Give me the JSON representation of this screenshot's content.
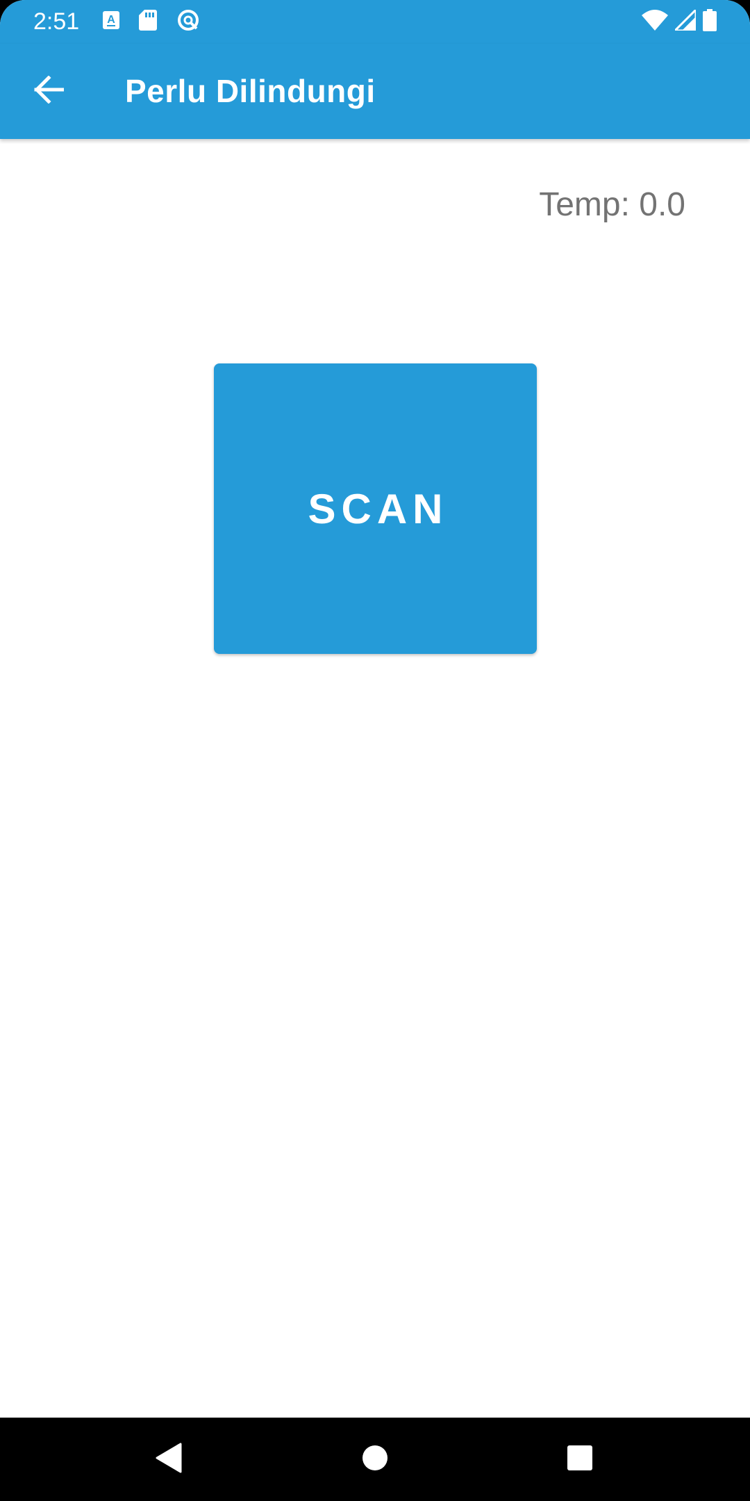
{
  "status_bar": {
    "time": "2:51",
    "left_icons": [
      "translate-icon",
      "sd-card-icon",
      "vpn-circle-icon"
    ],
    "right_icons": [
      "wifi-icon",
      "cell-signal-icon",
      "battery-icon"
    ]
  },
  "app_bar": {
    "title": "Perlu Dilindungi",
    "back_icon": "arrow-back-icon"
  },
  "main": {
    "temp_label": "Temp: 0.0",
    "scan_button_label": "SCAN"
  },
  "nav_bar": {
    "buttons": [
      "back-triangle-icon",
      "home-circle-icon",
      "recents-square-icon"
    ]
  },
  "colors": {
    "primary": "#259bd8",
    "temp_text": "#737373",
    "background": "#ffffff",
    "nav_bar": "#000000"
  }
}
